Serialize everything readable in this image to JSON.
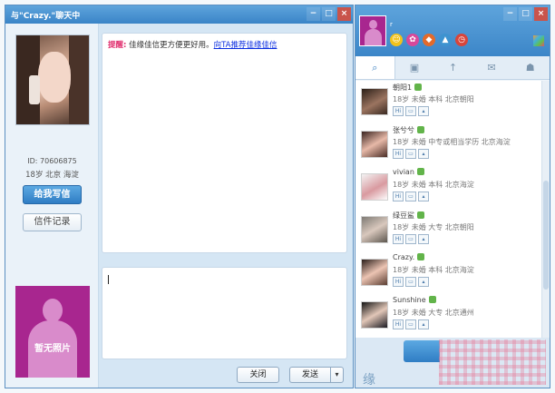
{
  "chat": {
    "title": "与\"Crazy.\"聊天中",
    "user_id": "ID: 70606875",
    "user_loc": "18岁 北京 海淀",
    "btn_letter": "给我写信",
    "btn_records": "信件记录",
    "no_photo": "暂无照片",
    "tip_label": "提醒:",
    "tip_text": " 佳缘佳信更方便更好用。",
    "tip_link": "向TA推荐佳缘佳信",
    "btn_close": "关闭",
    "btn_send": "发送",
    "win": {
      "min": "−",
      "max": "□",
      "close": "×"
    }
  },
  "panel": {
    "name": "r",
    "tabs": [
      {
        "icon": "search-icon",
        "glyph": "🔍"
      },
      {
        "icon": "chat-bubble-icon",
        "glyph": "▣"
      },
      {
        "icon": "umbrella-icon",
        "glyph": "↑"
      },
      {
        "icon": "mail-icon",
        "glyph": "✉"
      },
      {
        "icon": "group-icon",
        "glyph": "☗"
      }
    ],
    "emoticons": [
      {
        "icon": "smiley-icon",
        "color": "#f2c21b"
      },
      {
        "icon": "flower-icon",
        "color": "#d8489a"
      },
      {
        "icon": "gift-icon",
        "color": "#e46a2a"
      },
      {
        "icon": "mountain-icon",
        "color": "#3e93d0"
      },
      {
        "icon": "clock-icon",
        "color": "#d8453b"
      }
    ],
    "contacts": [
      {
        "name": "朝阳1",
        "info": "18岁 未婚 本科 北京朝阳"
      },
      {
        "name": "张兮兮",
        "info": "18岁 未婚 中专或相当学历 北京海淀"
      },
      {
        "name": "vivian",
        "info": "18岁 未婚 本科 北京海淀"
      },
      {
        "name": "绿豆鲨",
        "info": "18岁 未婚 大专 北京朝阳"
      },
      {
        "name": "Crazy.",
        "info": "18岁 未婚 本科 北京海淀"
      },
      {
        "name": "Sunshine",
        "info": "18岁 未婚 大专 北京通州"
      }
    ],
    "actions": [
      "Hi",
      "chat",
      "profile"
    ]
  }
}
